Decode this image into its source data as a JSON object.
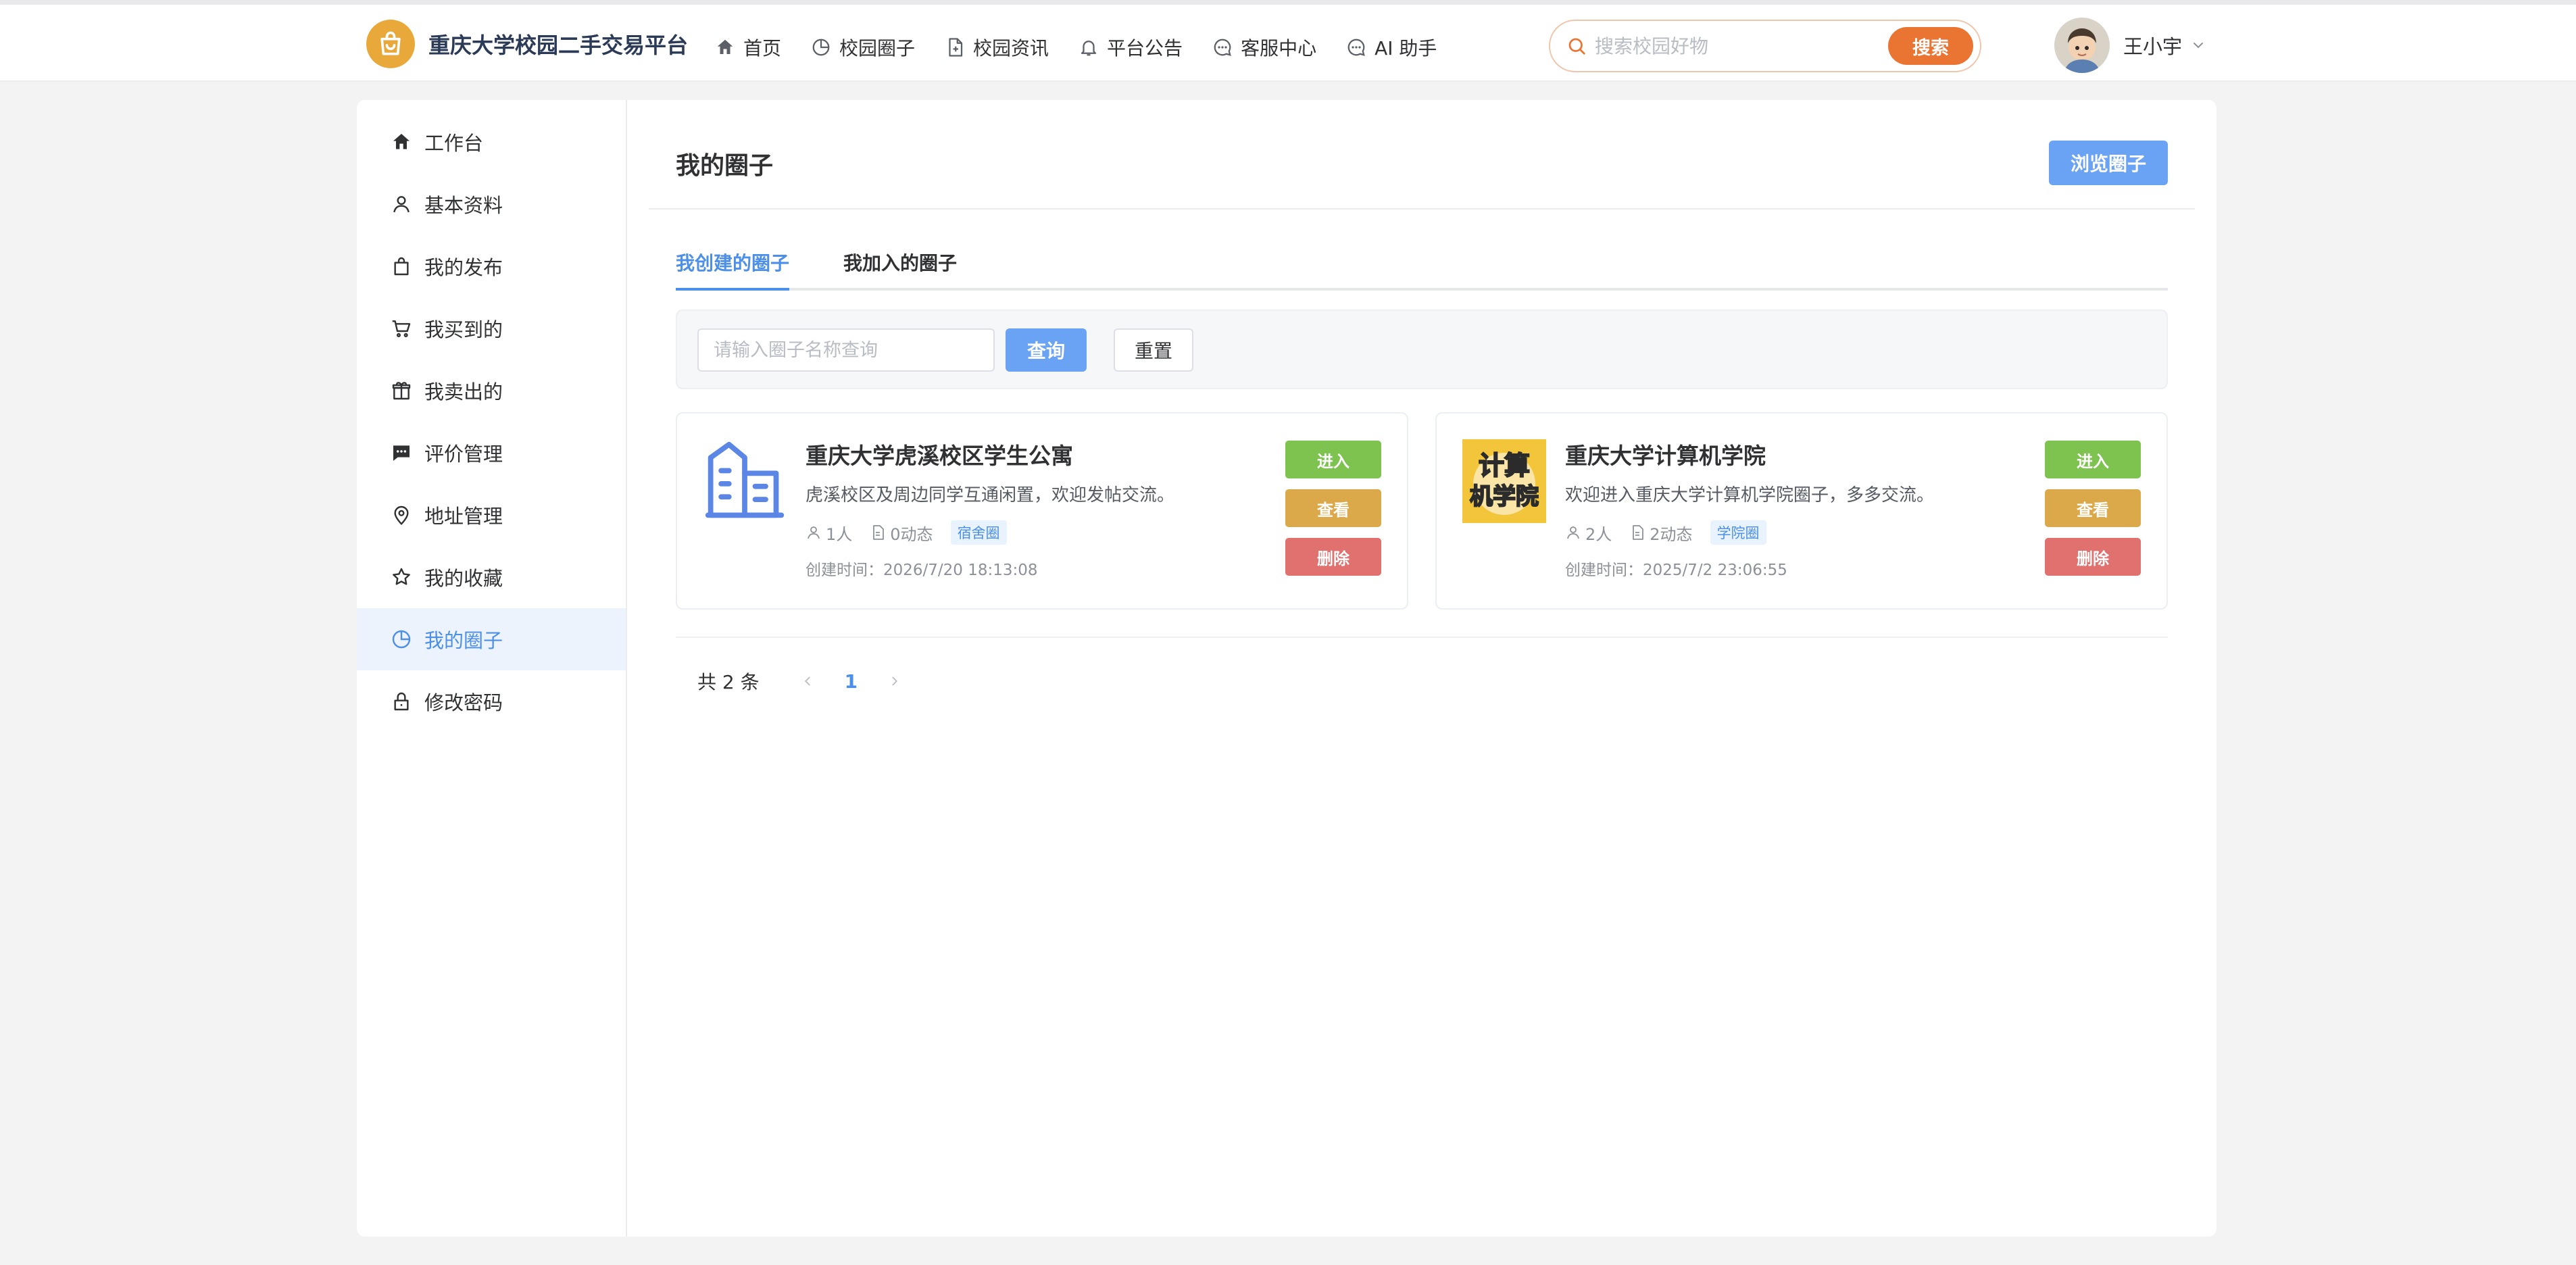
{
  "colors": {
    "accent": "#4c8fe8",
    "search_button": "#ea7533",
    "enter": "#7ec24f",
    "view": "#dba94a",
    "delete": "#e0716f",
    "brand_logo": "#e9a93a"
  },
  "header": {
    "brand_title": "重庆大学校园二手交易平台",
    "brand_icon": "shopping-bag-icon",
    "nav": [
      {
        "label": "首页",
        "icon": "home-icon"
      },
      {
        "label": "校园圈子",
        "icon": "pie-chart-icon"
      },
      {
        "label": "校园资讯",
        "icon": "document-icon"
      },
      {
        "label": "平台公告",
        "icon": "bell-icon"
      },
      {
        "label": "客服中心",
        "icon": "chat-icon"
      },
      {
        "label": "AI 助手",
        "icon": "chat-icon"
      }
    ],
    "search": {
      "placeholder": "搜索校园好物",
      "value": "",
      "button_label": "搜索"
    },
    "user": {
      "name": "王小宇"
    }
  },
  "sidebar": {
    "items": [
      {
        "label": "工作台",
        "icon": "home-icon"
      },
      {
        "label": "基本资料",
        "icon": "user-icon"
      },
      {
        "label": "我的发布",
        "icon": "bag-icon"
      },
      {
        "label": "我买到的",
        "icon": "cart-icon"
      },
      {
        "label": "我卖出的",
        "icon": "gift-icon"
      },
      {
        "label": "评价管理",
        "icon": "comment-icon"
      },
      {
        "label": "地址管理",
        "icon": "location-icon"
      },
      {
        "label": "我的收藏",
        "icon": "star-icon"
      },
      {
        "label": "我的圈子",
        "icon": "pie-chart-icon",
        "active": true
      },
      {
        "label": "修改密码",
        "icon": "lock-icon"
      }
    ]
  },
  "main": {
    "title": "我的圈子",
    "browse_label": "浏览圈子",
    "tabs": [
      {
        "label": "我创建的圈子",
        "active": true
      },
      {
        "label": "我加入的圈子",
        "active": false
      }
    ],
    "filter": {
      "placeholder": "请输入圈子名称查询",
      "value": "",
      "query_label": "查询",
      "reset_label": "重置"
    },
    "circles": [
      {
        "name": "重庆大学虎溪校区学生公寓",
        "desc": "虎溪校区及周边同学互通闲置，欢迎发帖交流。",
        "members": "1人",
        "posts": "0动态",
        "tag": "宿舍圈",
        "created": "创建时间：2026/7/20 18:13:08",
        "image": "building-icon",
        "enter_label": "进入",
        "view_label": "查看",
        "delete_label": "删除"
      },
      {
        "name": "重庆大学计算机学院",
        "desc": "欢迎进入重庆大学计算机学院圈子，多多交流。",
        "members": "2人",
        "posts": "2动态",
        "tag": "学院圈",
        "created": "创建时间：2025/7/2 23:06:55",
        "image": "college-logo",
        "image_text": [
          "计算",
          "机学院"
        ],
        "enter_label": "进入",
        "view_label": "查看",
        "delete_label": "删除"
      }
    ],
    "pagination": {
      "total_text": "共 2 条",
      "current_page": "1"
    }
  }
}
